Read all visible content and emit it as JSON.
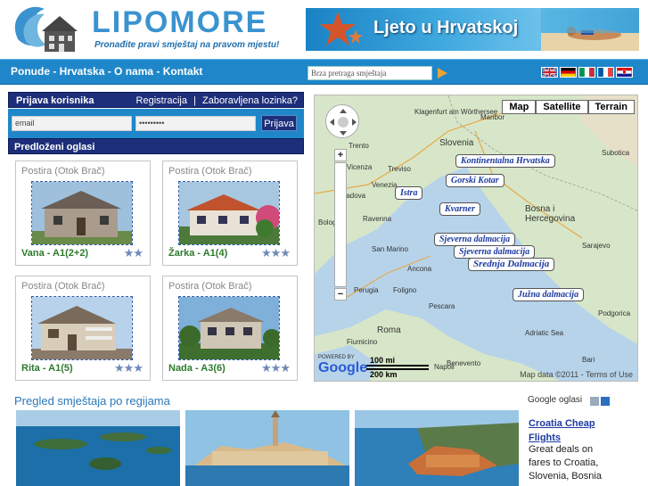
{
  "header": {
    "logo_text": "LIPOMORE",
    "tagline": "Pronađite pravi smještaj na pravom mjestu!",
    "banner_text": "Ljeto u Hrvatskoj"
  },
  "nav": {
    "links": "Ponude - Hrvatska - O nama - Kontakt",
    "search_placeholder": "Brza pretraga smještaja",
    "flags": [
      "flag-uk-icon",
      "flag-de-icon",
      "flag-it-icon",
      "flag-fr-icon",
      "flag-hr-icon"
    ]
  },
  "login": {
    "title": "Prijava korisnika",
    "register": "Registracija",
    "separator": "|",
    "forgot": "Zaboravljena lozinka?",
    "email_placeholder": "email",
    "password_mask": "•••••••••",
    "button": "Prijava"
  },
  "featured": {
    "title": "Predloženi oglasi",
    "cards": [
      {
        "location": "Postira (Otok Brač)",
        "name": "Vana - A1(2+2)",
        "stars": "★★"
      },
      {
        "location": "Postira (Otok Brač)",
        "name": "Žarka - A1(4)",
        "stars": "★★★"
      },
      {
        "location": "Postira (Otok Brač)",
        "name": "Rita - A1(5)",
        "stars": "★★★"
      },
      {
        "location": "Postira (Otok Brač)",
        "name": "Nada - A3(6)",
        "stars": "★★★"
      }
    ]
  },
  "map": {
    "buttons": [
      "Map",
      "Satellite",
      "Terrain"
    ],
    "regions": [
      "Kontinentalna Hrvatska",
      "Gorski Kotar",
      "Istra",
      "Kvarner",
      "Sjeverna dalmacija",
      "Sjeverna dalmacija",
      "Srednja Dalmacija",
      "Južna dalmacija"
    ],
    "cities": [
      "Klagenfurt am Wörthersee",
      "Maribor",
      "Slovenia",
      "Trento",
      "Vicenza",
      "Treviso",
      "Venezia",
      "Padova",
      "Bologna",
      "Ravenna",
      "San Marino",
      "Ancona",
      "Perugia",
      "Foligno",
      "Pescara",
      "Roma",
      "Napoli",
      "Benevento",
      "Fiumicino",
      "Bosna i Hercegovina",
      "Sarajevo",
      "Subotica",
      "Podgorica",
      "Adriatic Sea",
      "Bari"
    ],
    "powered_by": "POWERED BY",
    "google": "Google",
    "scale_mi": "100 mi",
    "scale_km": "200 km",
    "map_data": "Map data ©2011 - Terms of Use"
  },
  "regions": {
    "title": "Pregled smještaja po regijama"
  },
  "ads": {
    "header": "Google oglasi",
    "link_line1": "Croatia Cheap",
    "link_line2": "Flights",
    "body_line1": "Great deals on",
    "body_line2": "fares to Croatia,",
    "body_line3": "Slovenia, Bosnia"
  },
  "colors": {
    "nav_blue": "#1f87c9",
    "dark_navy": "#1d2f7a",
    "logo_blue": "#3a93cf",
    "name_green": "#2d7a2d"
  }
}
